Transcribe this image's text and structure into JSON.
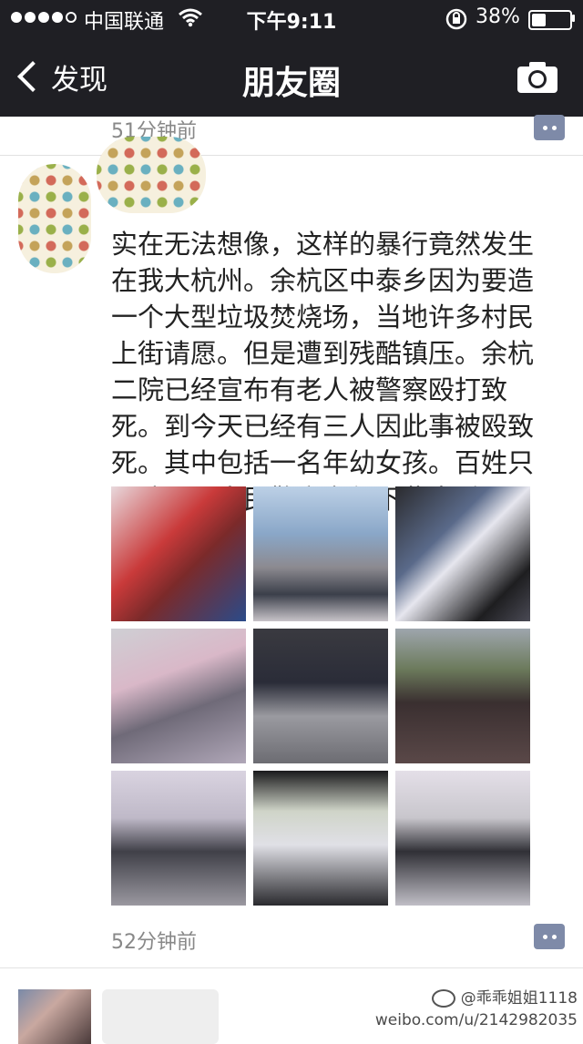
{
  "status_bar": {
    "carrier": "中国联通",
    "time": "下午9:11",
    "battery_percent": "38%",
    "battery_level": 0.38,
    "icons": [
      "signal-dots",
      "wifi-icon",
      "orientation-lock-icon",
      "battery-icon"
    ]
  },
  "nav": {
    "back_label": "发现",
    "title": "朋友圈",
    "camera_icon": "camera-icon"
  },
  "feed": {
    "prev_timestamp": "51分钟前",
    "post": {
      "text": "实在无法想像，这样的暴行竟然发生在我大杭州。余杭区中泰乡因为要造一个大型垃圾焚烧场，当地许多村民上街请愿。但是遭到残酷镇压。余杭二院已经宣布有老人被警察殴打致死。到今天已经有三人因此事被殴致死。其中包括一名年幼女孩。百姓只是请愿，人民警察为何下此毒手？",
      "photo_count": 9,
      "timestamp": "52分钟前"
    }
  },
  "watermark": {
    "handle": "@乖乖姐姐1118",
    "url": "weibo.com/u/2142982035"
  },
  "colors": {
    "bar": "#1f1f24",
    "comment_button": "#7e8aa8"
  }
}
